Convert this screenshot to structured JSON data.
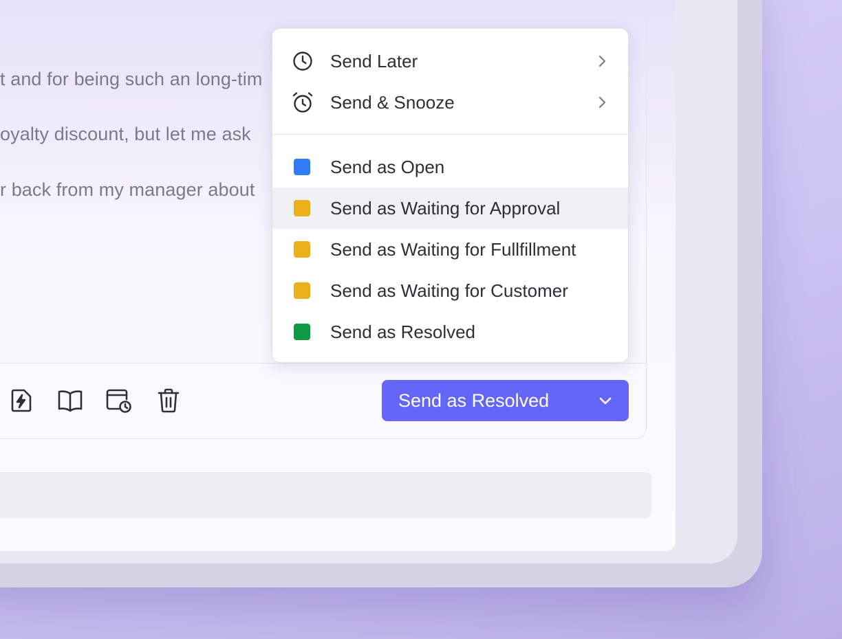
{
  "message": {
    "lines": [
      "t and for being such an long-tim",
      "oyalty discount, but let me ask",
      "r back from my manager about"
    ]
  },
  "toolbar": {
    "icons": [
      "lightning-file-icon",
      "book-icon",
      "calendar-clock-icon",
      "trash-icon"
    ]
  },
  "send_button": {
    "label": "Send as Resolved",
    "color": "#6466f7"
  },
  "menu": {
    "schedule_items": [
      {
        "label": "Send Later",
        "icon": "clock-icon"
      },
      {
        "label": "Send & Snooze",
        "icon": "alarm-clock-icon"
      }
    ],
    "status_items": [
      {
        "label": "Send as Open",
        "color": "#2f7cf6"
      },
      {
        "label": "Send as Waiting for Approval",
        "color": "#ecb01c",
        "highlighted": true
      },
      {
        "label": "Send as Waiting for Fullfillment",
        "color": "#ecb01c"
      },
      {
        "label": "Send as Waiting for Customer",
        "color": "#ecb01c"
      },
      {
        "label": "Send as Resolved",
        "color": "#0e9a43"
      }
    ]
  }
}
